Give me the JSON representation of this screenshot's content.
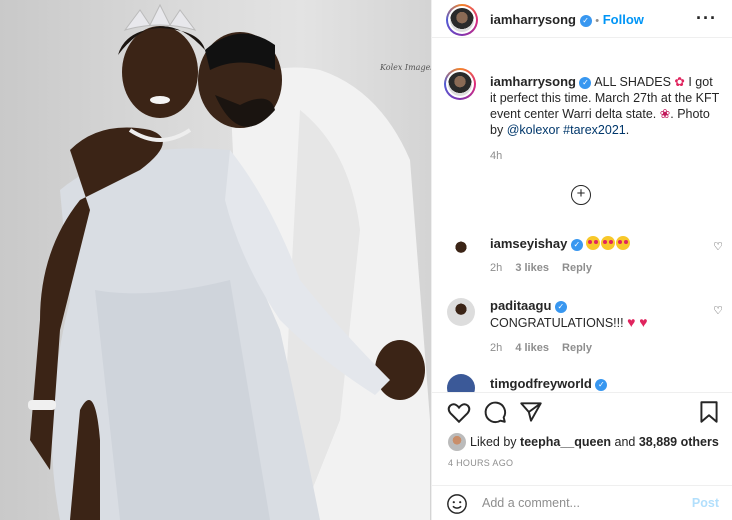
{
  "post": {
    "author": "iamharrysong",
    "follow_separator": "•",
    "follow_label": "Follow",
    "more_icon": "more-horizontal-icon",
    "photo_watermark": "Kolex Images"
  },
  "caption": {
    "author": "iamharrysong",
    "text_1": " ALL SHADES ",
    "text_2": " I got it perfect this time. March 27th at the KFT event center Warri delta state. ",
    "text_3": ". Photo by ",
    "mention": "@kolexor",
    "space": " ",
    "hashtag": "#tarex2021",
    "text_4": ".",
    "time": "4h"
  },
  "load_more_icon": "plus-circle-icon",
  "comments": [
    {
      "user": "iamseyishay",
      "text": "",
      "emojis": 3,
      "time": "2h",
      "likes": "3 likes",
      "reply": "Reply"
    },
    {
      "user": "paditaagu",
      "text": "CONGRATULATIONS!!! ",
      "hearts": "♥ ♥",
      "time": "2h",
      "likes": "4 likes",
      "reply": "Reply"
    },
    {
      "user": "timgodfreyworld"
    }
  ],
  "actions": {
    "liked_by_prefix": "Liked by ",
    "liked_by_user": "teepha__queen",
    "liked_by_suffix": " and ",
    "others": "38,889 others",
    "timestamp": "4 HOURS AGO"
  },
  "add_comment": {
    "placeholder": "Add a comment...",
    "post_label": "Post"
  },
  "colors": {
    "accent": "#0095f6",
    "verified": "#3897f0",
    "heart": "#e0245e"
  }
}
